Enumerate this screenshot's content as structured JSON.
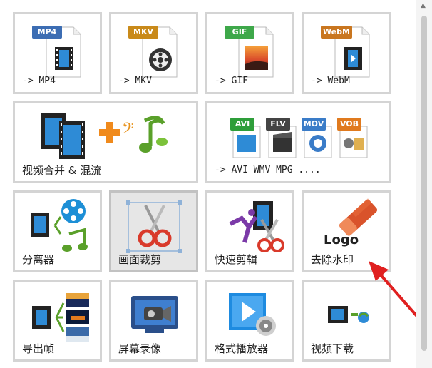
{
  "tiles": [
    {
      "label": "-> MP4",
      "badge": "MP4"
    },
    {
      "label": "-> MKV",
      "badge": "MKV"
    },
    {
      "label": "-> GIF",
      "badge": "GIF"
    },
    {
      "label": "-> WebM",
      "badge": "WebM"
    },
    {
      "label": "视频合并 & 混流"
    },
    {
      "label": "-> AVI WMV MPG ....",
      "badges": [
        "AVI",
        "FLV",
        "MOV",
        "VOB"
      ]
    },
    {
      "label": "分离器"
    },
    {
      "label": "画面裁剪",
      "selected": true
    },
    {
      "label": "快速剪辑"
    },
    {
      "label": "去除水印",
      "logo_text": "Logo"
    },
    {
      "label": "导出帧"
    },
    {
      "label": "屏幕录像"
    },
    {
      "label": "格式播放器"
    },
    {
      "label": "视频下载"
    }
  ],
  "colors": {
    "mp4": "#3c6db3",
    "mkv": "#c98a1a",
    "gif": "#3ea84a",
    "webm": "#c9761f",
    "avi": "#2e9e3a",
    "flv": "#444444",
    "mov": "#3a7cc8",
    "vob": "#e07a1e",
    "arrow": "#e02020",
    "tile_border": "#d4d4d4",
    "selected_bg": "#e6e6e6"
  }
}
